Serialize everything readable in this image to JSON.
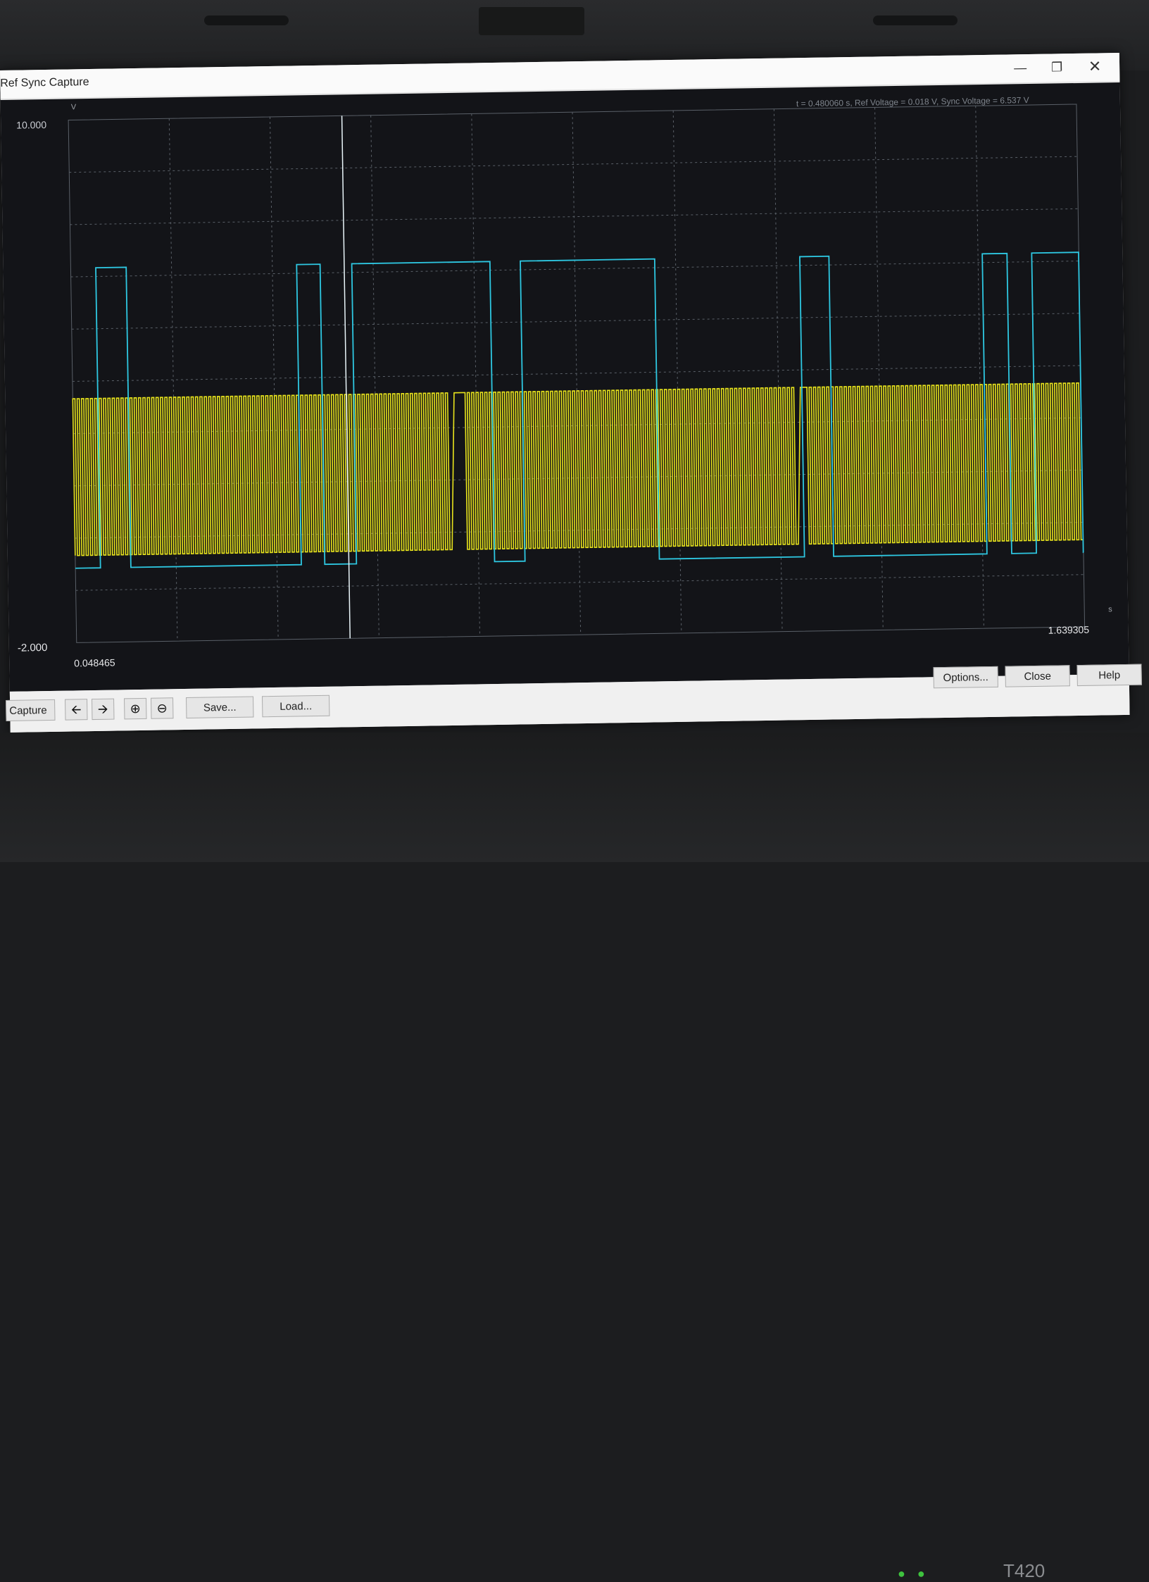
{
  "window": {
    "title": "Ref Sync Capture",
    "minimize_icon": "minimize-icon",
    "restore_icon": "restore-icon",
    "close_icon": "close-icon"
  },
  "plot": {
    "y_max_label": "10.000",
    "y_min_label": "-2.000",
    "y_unit": "V",
    "x_start_label": "0.048465",
    "x_end_label": "1.639305",
    "x_unit": "s",
    "readout": "t = 0.480060 s, Ref Voltage = 0.018 V, Sync Voltage = 6.537 V",
    "background": "#131418",
    "ref_color": "#e8e41c",
    "sync_color": "#2ec8e2",
    "grid_color": "#5a6068"
  },
  "chart_data": {
    "type": "line",
    "xlim": [
      0.048465,
      1.639305
    ],
    "ylim": [
      -2.0,
      10.0
    ],
    "xlabel": "s",
    "ylabel": "V",
    "grid": true,
    "cursor_t": 0.48006,
    "series": [
      {
        "name": "Ref Voltage",
        "kind": "square_wave",
        "low": 0.0,
        "high": 3.6,
        "x_start": 0.048465,
        "x_end": 1.639305,
        "pulse_count": 230,
        "gaps": [
          [
            0.643,
            0.66
          ],
          [
            1.183,
            1.2
          ]
        ]
      },
      {
        "name": "Sync Voltage",
        "kind": "pulses",
        "low": 0.0,
        "high": 6.6,
        "pulses": [
          [
            0.088,
            0.136
          ],
          [
            0.405,
            0.442
          ],
          [
            0.492,
            0.71
          ],
          [
            0.758,
            0.97
          ],
          [
            1.199,
            1.245
          ],
          [
            1.487,
            1.526
          ],
          [
            1.565,
            1.639
          ]
        ]
      }
    ]
  },
  "toolbar": {
    "capture_label": "Capture",
    "back_icon": "arrow-left-icon",
    "forward_icon": "arrow-right-icon",
    "zoom_in_icon": "zoom-in-icon",
    "zoom_out_icon": "zoom-out-icon",
    "save_label": "Save...",
    "load_label": "Load...",
    "options_label": "Options...",
    "close_label": "Close",
    "help_label": "Help"
  },
  "laptop": {
    "model": "T420"
  }
}
